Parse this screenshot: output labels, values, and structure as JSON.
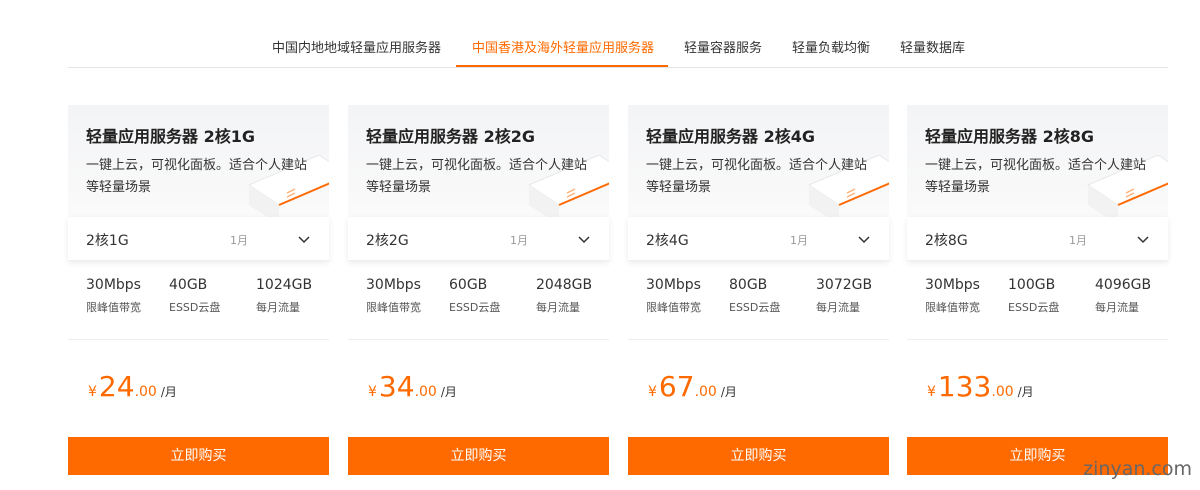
{
  "tabs": [
    {
      "label": "中国内地地域轻量应用服务器"
    },
    {
      "label": "中国香港及海外轻量应用服务器"
    },
    {
      "label": "轻量容器服务"
    },
    {
      "label": "轻量负载均衡"
    },
    {
      "label": "轻量数据库"
    }
  ],
  "active_tab": 1,
  "colors": {
    "accent": "#ff6a00"
  },
  "cards": [
    {
      "title": "轻量应用服务器 2核1G",
      "desc": "一键上云，可视化面板。适合个人建站等轻量场景",
      "select": "2核1G",
      "period": "1月",
      "specs": [
        {
          "v": "30Mbps",
          "l": "限峰值带宽"
        },
        {
          "v": "40GB",
          "l": "ESSD云盘"
        },
        {
          "v": "1024GB",
          "l": "每月流量"
        }
      ],
      "price": {
        "currency": "¥",
        "int": "24",
        "dec": ".00",
        "unit": "/月"
      },
      "buy": "立即购买"
    },
    {
      "title": "轻量应用服务器 2核2G",
      "desc": "一键上云，可视化面板。适合个人建站等轻量场景",
      "select": "2核2G",
      "period": "1月",
      "specs": [
        {
          "v": "30Mbps",
          "l": "限峰值带宽"
        },
        {
          "v": "60GB",
          "l": "ESSD云盘"
        },
        {
          "v": "2048GB",
          "l": "每月流量"
        }
      ],
      "price": {
        "currency": "¥",
        "int": "34",
        "dec": ".00",
        "unit": "/月"
      },
      "buy": "立即购买"
    },
    {
      "title": "轻量应用服务器 2核4G",
      "desc": "一键上云，可视化面板。适合个人建站等轻量场景",
      "select": "2核4G",
      "period": "1月",
      "specs": [
        {
          "v": "30Mbps",
          "l": "限峰值带宽"
        },
        {
          "v": "80GB",
          "l": "ESSD云盘"
        },
        {
          "v": "3072GB",
          "l": "每月流量"
        }
      ],
      "price": {
        "currency": "¥",
        "int": "67",
        "dec": ".00",
        "unit": "/月"
      },
      "buy": "立即购买"
    },
    {
      "title": "轻量应用服务器 2核8G",
      "desc": "一键上云，可视化面板。适合个人建站等轻量场景",
      "select": "2核8G",
      "period": "1月",
      "specs": [
        {
          "v": "30Mbps",
          "l": "限峰值带宽"
        },
        {
          "v": "100GB",
          "l": "ESSD云盘"
        },
        {
          "v": "4096GB",
          "l": "每月流量"
        }
      ],
      "price": {
        "currency": "¥",
        "int": "133",
        "dec": ".00",
        "unit": "/月"
      },
      "buy": "立即购买"
    }
  ],
  "watermark": "zinyan.com"
}
